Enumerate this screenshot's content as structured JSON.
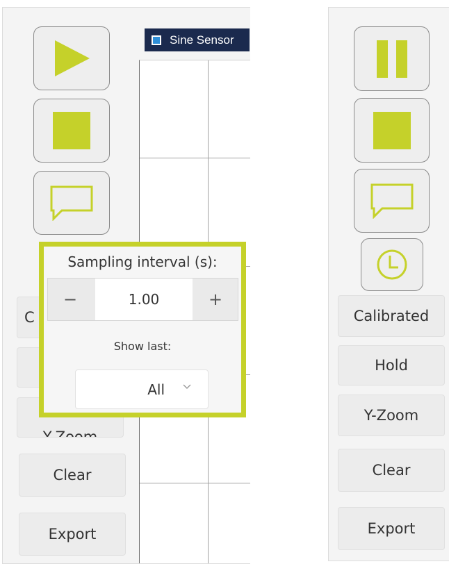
{
  "left_panel": {
    "toolbar": [
      {
        "name": "play-button",
        "icon": "play-icon"
      },
      {
        "name": "stop-button",
        "icon": "stop-icon"
      },
      {
        "name": "annotate-button",
        "icon": "speech-bubble-icon"
      }
    ],
    "partial_buttons": [
      {
        "name": "calibrated-button",
        "label": "C"
      },
      {
        "name": "hold-button",
        "label": ""
      },
      {
        "name": "y-zoom-button",
        "label": "Y-Zoom"
      }
    ],
    "clear_label": "Clear",
    "export_label": "Export"
  },
  "chart": {
    "legend_label": "Sine Sensor"
  },
  "popup": {
    "title": "Sampling interval (s):",
    "minus_label": "−",
    "plus_label": "+",
    "interval_value": "1.00",
    "show_last_label": "Show last:",
    "show_last_value": "All"
  },
  "right_panel": {
    "toolbar": [
      {
        "name": "pause-button",
        "icon": "pause-icon"
      },
      {
        "name": "stop-button",
        "icon": "stop-icon"
      },
      {
        "name": "annotate-button",
        "icon": "speech-bubble-icon"
      },
      {
        "name": "timer-button",
        "icon": "clock-icon"
      }
    ],
    "buttons": [
      {
        "name": "calibrated-button",
        "label": "Calibrated"
      },
      {
        "name": "hold-button",
        "label": "Hold"
      },
      {
        "name": "y-zoom-button",
        "label": "Y-Zoom"
      },
      {
        "name": "clear-button",
        "label": "Clear"
      },
      {
        "name": "export-button",
        "label": "Export"
      }
    ]
  },
  "colors": {
    "accent": "#c5d12a",
    "legend_bg": "#1b2a4e",
    "legend_check": "#2f8fd8"
  }
}
